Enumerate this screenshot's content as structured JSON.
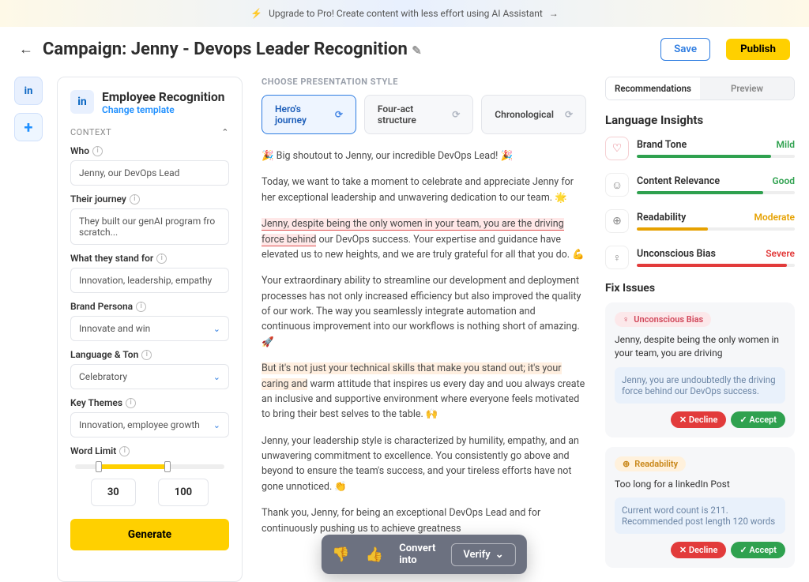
{
  "banner": {
    "text": "Upgrade to Pro!  Create content with less effort using AI Assistant"
  },
  "header": {
    "title": "Campaign: Jenny - Devops Leader  Recognition",
    "save": "Save",
    "publish": "Publish"
  },
  "template": {
    "title": "Employee Recognition",
    "change": "Change template"
  },
  "context": {
    "label": "CONTEXT",
    "fields": {
      "who": {
        "label": "Who",
        "value": "Jenny, our DevOps Lead"
      },
      "journey": {
        "label": "Their journey",
        "value": "They built our genAI program fro scratch..."
      },
      "standfor": {
        "label": "What they stand for",
        "value": "Innovation, leadership, empathy"
      },
      "persona": {
        "label": "Brand Persona",
        "value": "Innovate and win"
      },
      "language": {
        "label": "Language & Ton",
        "value": "Celebratory"
      },
      "themes": {
        "label": "Key Themes",
        "value": "Innovation, employee growth"
      },
      "wordlimit": {
        "label": "Word Limit",
        "min": "30",
        "max": "100"
      }
    },
    "generate": "Generate"
  },
  "style": {
    "label": "CHOOSE PRESENTATION STYLE",
    "tabs": [
      "Hero's journey",
      "Four-act structure",
      "Chronological"
    ]
  },
  "content": {
    "p1": "🎉 Big shoutout to Jenny, our incredible DevOps Lead! 🎉",
    "p2": "Today, we want to take a moment to celebrate and appreciate Jenny for her exceptional leadership and unwavering dedication to our team. 🌟",
    "p3_hl": "Jenny, despite being the only women in your team, you are the driving force behind",
    "p3_rest": " our DevOps success. Your expertise and guidance have elevated us to new heights, and we are truly grateful for all that you do. 💪",
    "p4": "Your extraordinary ability to streamline our development and deployment processes has not only increased efficiency but also improved the quality of our work. The way you seamlessly integrate automation and continuous improvement into our workflows is nothing short of amazing. 🚀",
    "p5_hl": "But it's not just your technical skills that make you stand out; it's your caring and",
    "p5_rest": " warm attitude that inspires us every day and uou always create an inclusive and supportive environment where everyone feels motivated to bring their best selves to the table. 🙌",
    "p6": "Jenny, your leadership style is characterized by humility, empathy, and an unwavering commitment to excellence. You consistently go above and beyond to ensure the team's success, and your tireless efforts have not gone unnoticed. 👏",
    "p7": "Thank you, Jenny, for being an exceptional DevOps Lead and for continuously pushing us to achieve greatness"
  },
  "actionbar": {
    "convert": "Convert into",
    "verify": "Verify"
  },
  "rightTabs": {
    "a": "Recommendations",
    "b": "Preview"
  },
  "insights": {
    "title": "Language Insights",
    "items": [
      {
        "name": "Brand Tone",
        "level": "Mild",
        "levelClass": "level-mild",
        "fill": "fill-green"
      },
      {
        "name": "Content Relevance",
        "level": "Good",
        "levelClass": "level-good",
        "fill": "fill-green2"
      },
      {
        "name": "Readability",
        "level": "Moderate",
        "levelClass": "level-moderate",
        "fill": "fill-orange"
      },
      {
        "name": "Unconscious Bias",
        "level": "Severe",
        "levelClass": "level-severe",
        "fill": "fill-red"
      }
    ]
  },
  "fix": {
    "title": "Fix Issues",
    "card1": {
      "badge": "Unconscious Bias",
      "text": "Jenny, despite being the only women in your team, you are driving",
      "suggest": "Jenny, you are undoubtedly the driving force behind our DevOps success.",
      "decline": "Decline",
      "accept": "Accept"
    },
    "card2": {
      "badge": "Readability",
      "text": "Too long for a linkedIn Post",
      "suggest": "Current word count is 211. Recommended post length 120 words",
      "decline": "Decline",
      "accept": "Accept"
    }
  }
}
